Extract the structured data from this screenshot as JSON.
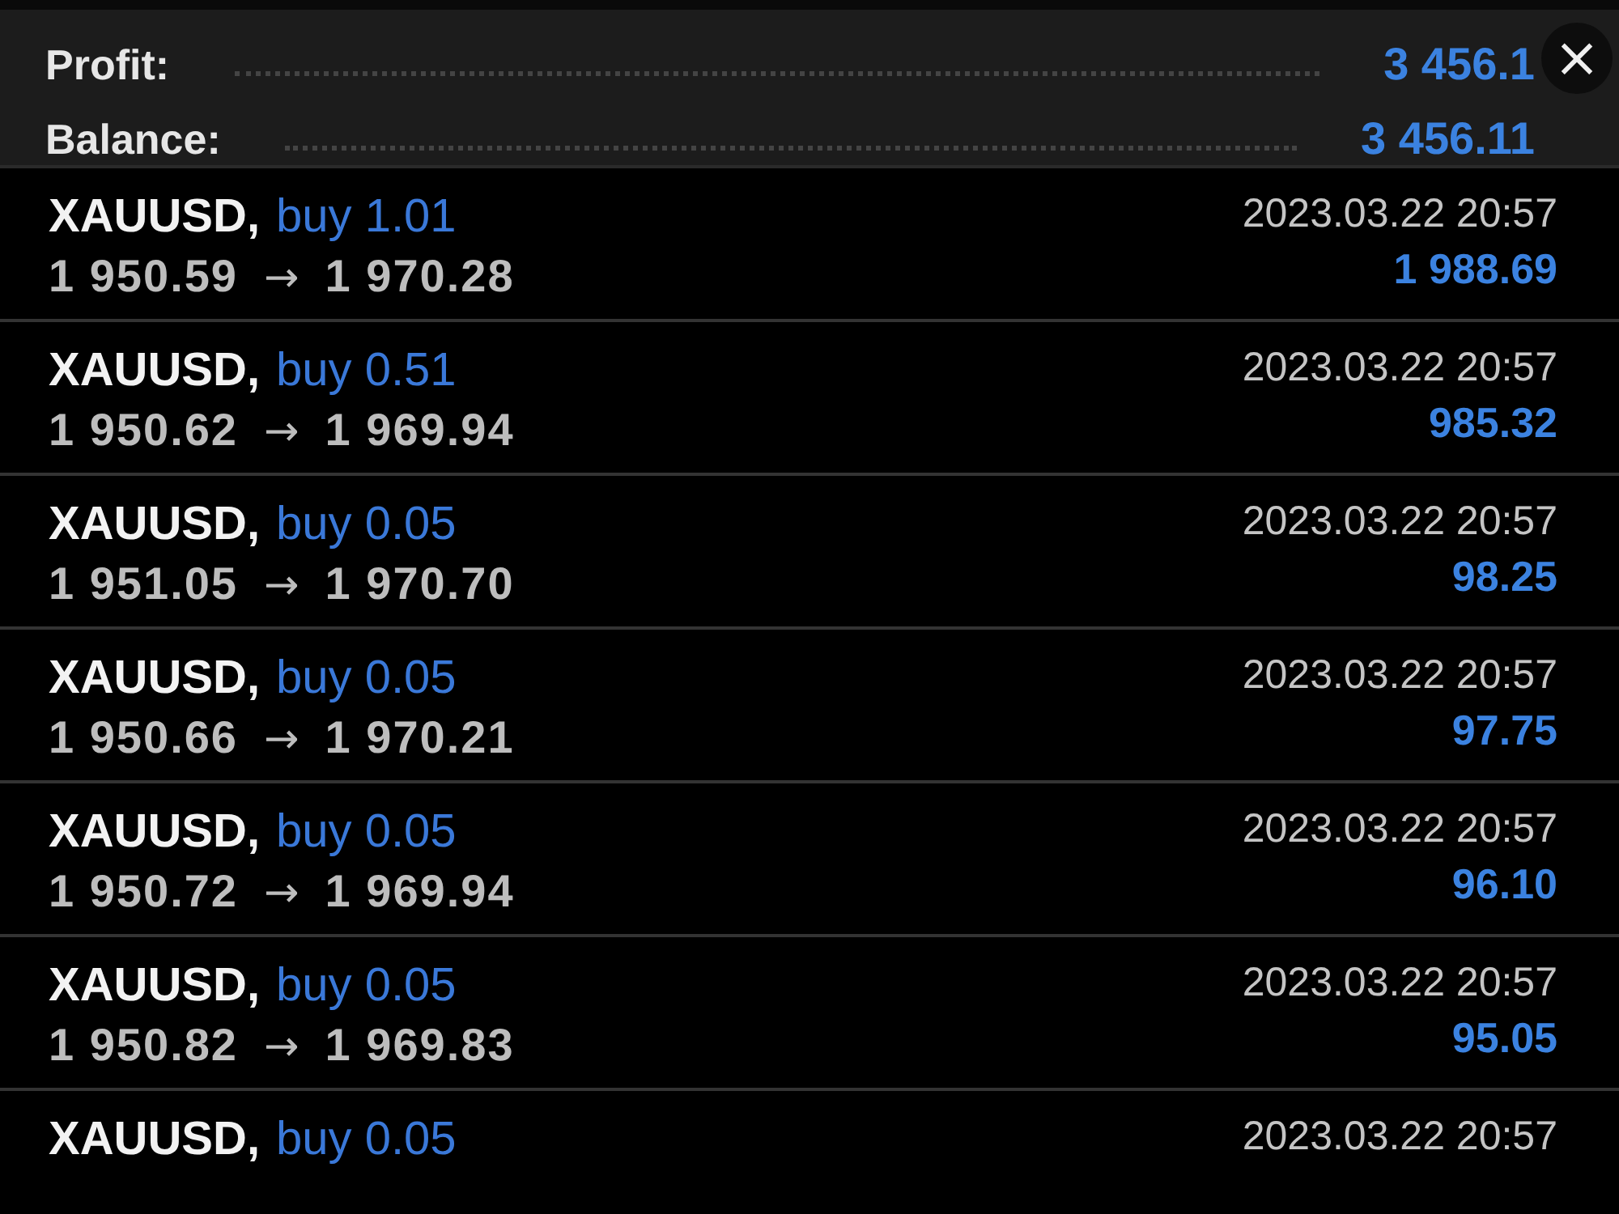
{
  "summary": [
    {
      "label": "Profit:",
      "value": "3 456.1"
    },
    {
      "label": "Balance:",
      "value": "3 456.11"
    }
  ],
  "close": {
    "glyph": "×"
  },
  "trades": [
    {
      "symbol": "XAUUSD,",
      "order": "buy 1.01",
      "open": "1 950.59",
      "arrow": "→",
      "close": "1 970.28",
      "time": "2023.03.22 20:57",
      "profit": "1 988.69"
    },
    {
      "symbol": "XAUUSD,",
      "order": "buy 0.51",
      "open": "1 950.62",
      "arrow": "→",
      "close": "1 969.94",
      "time": "2023.03.22 20:57",
      "profit": "985.32"
    },
    {
      "symbol": "XAUUSD,",
      "order": "buy 0.05",
      "open": "1 951.05",
      "arrow": "→",
      "close": "1 970.70",
      "time": "2023.03.22 20:57",
      "profit": "98.25"
    },
    {
      "symbol": "XAUUSD,",
      "order": "buy 0.05",
      "open": "1 950.66",
      "arrow": "→",
      "close": "1 970.21",
      "time": "2023.03.22 20:57",
      "profit": "97.75"
    },
    {
      "symbol": "XAUUSD,",
      "order": "buy 0.05",
      "open": "1 950.72",
      "arrow": "→",
      "close": "1 969.94",
      "time": "2023.03.22 20:57",
      "profit": "96.10"
    },
    {
      "symbol": "XAUUSD,",
      "order": "buy 0.05",
      "open": "1 950.82",
      "arrow": "→",
      "close": "1 969.83",
      "time": "2023.03.22 20:57",
      "profit": "95.05"
    },
    {
      "symbol": "XAUUSD,",
      "order": "buy 0.05",
      "time": "2023.03.22 20:57"
    }
  ]
}
